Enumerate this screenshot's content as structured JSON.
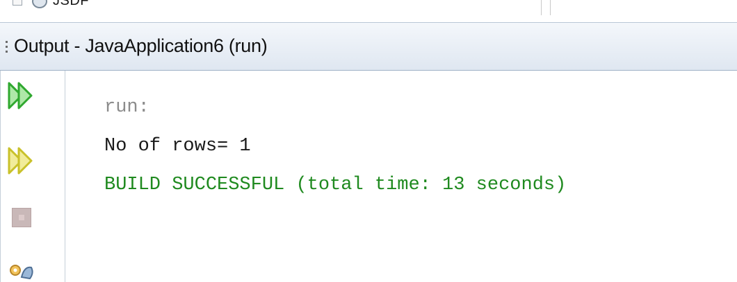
{
  "tree": {
    "label": "JSDF",
    "toggle_icon": "expand-toggle-icon",
    "node_icon": "library-icon"
  },
  "window": {
    "title": "Output - JavaApplication6 (run)"
  },
  "toolbar": {
    "buttons": [
      {
        "name": "rerun-icon",
        "color": "#2fa82f"
      },
      {
        "name": "rerun-with-options-icon",
        "color": "#c9c12a"
      },
      {
        "name": "stop-icon",
        "color": "#c9b8b8"
      },
      {
        "name": "settings-icon",
        "color": "#d9a640"
      }
    ]
  },
  "console": {
    "lines": [
      {
        "text": "run:",
        "color": "#8c8c8c"
      },
      {
        "text": "No of rows= 1",
        "color": "#1a1a1a"
      },
      {
        "text": "BUILD SUCCESSFUL (total time: 13 seconds)",
        "color": "#1f8a1f"
      }
    ]
  }
}
